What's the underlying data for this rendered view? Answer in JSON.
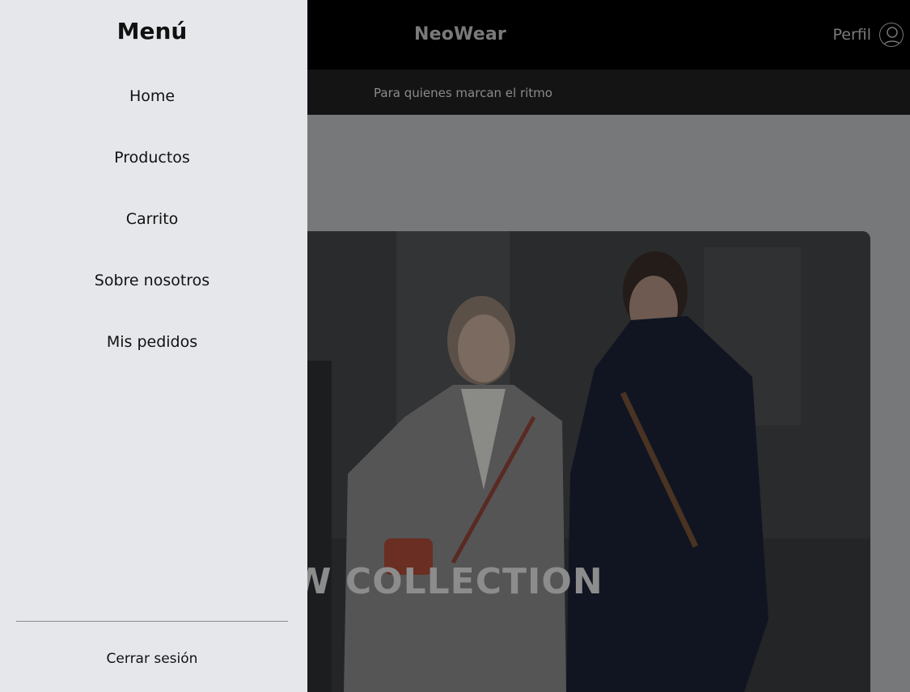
{
  "header": {
    "brand": "NeoWear",
    "profile_label": "Perfil",
    "profile_icon": "user-circle-icon"
  },
  "subheader": {
    "tagline": "Para quienes marcan el ritmo"
  },
  "hero": {
    "title": "EW COLLECTION"
  },
  "drawer": {
    "title": "Menú",
    "items": [
      {
        "label": "Home"
      },
      {
        "label": "Productos"
      },
      {
        "label": "Carrito"
      },
      {
        "label": "Sobre nosotros"
      },
      {
        "label": "Mis pedidos"
      }
    ],
    "logout_label": "Cerrar sesión"
  },
  "colors": {
    "drawer_bg": "#e5e7eb",
    "header_bg": "#000000",
    "overlay": "#777879"
  }
}
